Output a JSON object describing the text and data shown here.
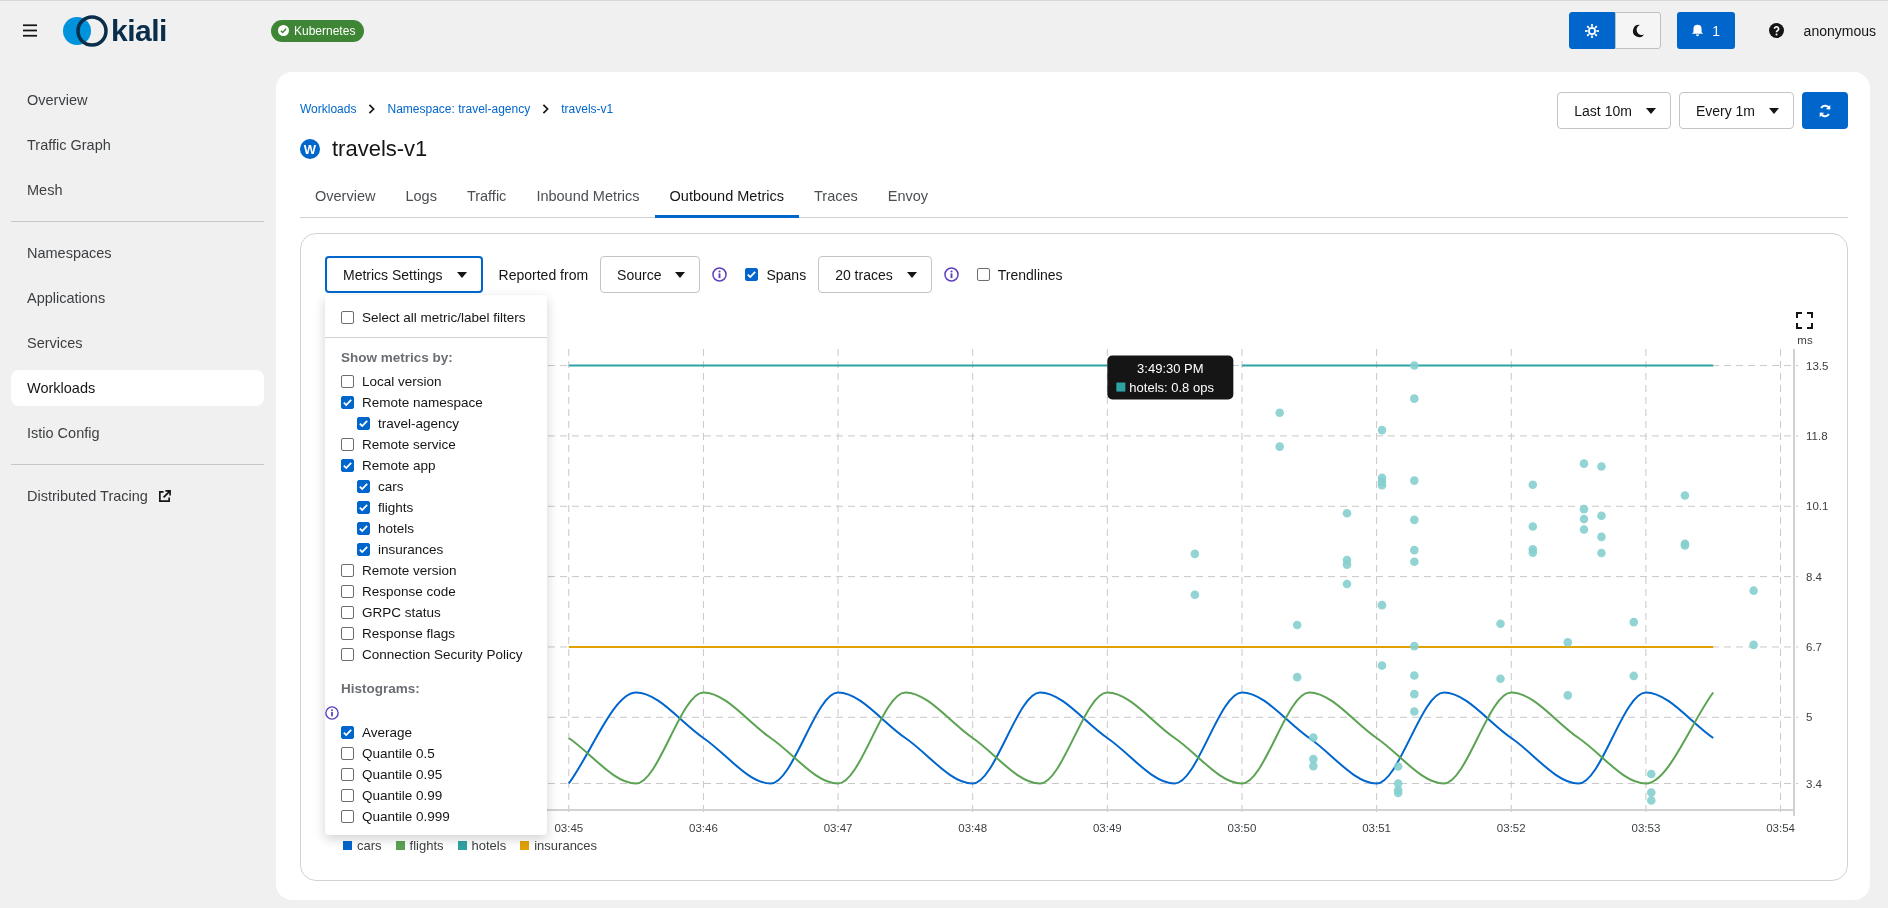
{
  "topbar": {
    "logo": "kiali",
    "cluster_badge": "Kubernetes",
    "theme_toggle": [
      {
        "kind": "light",
        "selected": true
      },
      {
        "kind": "dark",
        "selected": false
      }
    ],
    "notifications": "1",
    "user": "anonymous"
  },
  "sidebar": {
    "groups": [
      [
        {
          "label": "Overview",
          "selected": false
        },
        {
          "label": "Traffic Graph",
          "selected": false
        },
        {
          "label": "Mesh",
          "selected": false
        }
      ],
      [
        {
          "label": "Namespaces",
          "selected": false
        },
        {
          "label": "Applications",
          "selected": false
        },
        {
          "label": "Services",
          "selected": false
        },
        {
          "label": "Workloads",
          "selected": true
        },
        {
          "label": "Istio Config",
          "selected": false
        }
      ],
      [
        {
          "label": "Distributed Tracing",
          "selected": false,
          "external": true
        }
      ]
    ]
  },
  "breadcrumbs": [
    "Workloads",
    "Namespace: travel-agency",
    "travels-v1"
  ],
  "title": {
    "badge": "W",
    "text": "travels-v1"
  },
  "time_controls": {
    "range": "Last 10m",
    "refresh": "Every 1m"
  },
  "tabs": [
    {
      "label": "Overview",
      "selected": false
    },
    {
      "label": "Logs",
      "selected": false
    },
    {
      "label": "Traffic",
      "selected": false
    },
    {
      "label": "Inbound Metrics",
      "selected": false
    },
    {
      "label": "Outbound Metrics",
      "selected": true
    },
    {
      "label": "Traces",
      "selected": false
    },
    {
      "label": "Envoy",
      "selected": false
    }
  ],
  "toolbar": {
    "settings_button": "Metrics Settings",
    "reported_from_label": "Reported from",
    "reported_from": "Source",
    "spans": {
      "label": "Spans",
      "checked": true
    },
    "traces": "20 traces",
    "trendlines": {
      "label": "Trendlines",
      "checked": false
    }
  },
  "metrics_menu": {
    "select_all": {
      "label": "Select all metric/label filters",
      "checked": false
    },
    "sections": [
      {
        "heading": "Show metrics by:",
        "items": [
          {
            "label": "Local version",
            "checked": false
          },
          {
            "label": "Remote namespace",
            "checked": true,
            "children": [
              {
                "label": "travel-agency",
                "checked": true
              }
            ]
          },
          {
            "label": "Remote service",
            "checked": false
          },
          {
            "label": "Remote app",
            "checked": true,
            "children": [
              {
                "label": "cars",
                "checked": true
              },
              {
                "label": "flights",
                "checked": true
              },
              {
                "label": "hotels",
                "checked": true
              },
              {
                "label": "insurances",
                "checked": true
              }
            ]
          },
          {
            "label": "Remote version",
            "checked": false
          },
          {
            "label": "Response code",
            "checked": false
          },
          {
            "label": "GRPC status",
            "checked": false
          },
          {
            "label": "Response flags",
            "checked": false
          },
          {
            "label": "Connection Security Policy",
            "checked": false
          }
        ]
      },
      {
        "heading": "Histograms:",
        "info": true,
        "items": [
          {
            "label": "Average",
            "checked": true
          },
          {
            "label": "Quantile 0.5",
            "checked": false
          },
          {
            "label": "Quantile 0.95",
            "checked": false
          },
          {
            "label": "Quantile 0.99",
            "checked": false
          },
          {
            "label": "Quantile 0.999",
            "checked": false
          }
        ]
      }
    ]
  },
  "chart": {
    "chart_data": {
      "type": "line",
      "ylabel": "ms",
      "grid": true,
      "categories": [
        null,
        "03:45",
        null,
        "03:46",
        null,
        "03:47",
        null,
        "03:48",
        null,
        "03:49",
        null,
        "03:50",
        null,
        "03:51",
        null,
        "03:52",
        null,
        "03:53",
        null,
        "03:54"
      ],
      "series": [
        {
          "name": "cars",
          "color": "#0066cc",
          "values": [
            null,
            3.4,
            5.6,
            4.5,
            3.4,
            5.6,
            4.5,
            3.4,
            5.6,
            4.5,
            3.4,
            5.6,
            4.5,
            3.4,
            5.6,
            4.5,
            3.4,
            5.6,
            4.5,
            null
          ]
        },
        {
          "name": "flights",
          "color": "#5ba352",
          "values": [
            null,
            4.5,
            3.4,
            5.6,
            4.5,
            3.4,
            5.6,
            4.5,
            3.4,
            5.6,
            4.5,
            3.4,
            5.6,
            4.5,
            3.4,
            5.6,
            4.5,
            3.4,
            5.6,
            null
          ]
        },
        {
          "name": "hotels",
          "color": "#2fa3a3",
          "values": [
            null,
            13.5,
            13.5,
            13.5,
            13.5,
            13.5,
            13.5,
            13.5,
            13.5,
            13.5,
            null,
            13.5,
            13.5,
            13.5,
            13.5,
            13.5,
            13.5,
            13.5,
            13.5,
            null
          ]
        },
        {
          "name": "insurances",
          "color": "#e0a200",
          "values": [
            null,
            6.7,
            6.7,
            6.7,
            6.7,
            6.7,
            6.7,
            6.7,
            6.7,
            6.7,
            6.7,
            6.7,
            6.7,
            6.7,
            6.7,
            6.7,
            6.7,
            6.7,
            6.7,
            null
          ]
        }
      ],
      "ylim": [
        2.76,
        13.9
      ],
      "yticks": [
        3.4,
        5,
        6.7,
        8.4,
        10.1,
        11.8,
        13.5
      ],
      "annotations": [
        "3:49:30 PM",
        "hotels: 0.8 ops"
      ]
    }
  }
}
